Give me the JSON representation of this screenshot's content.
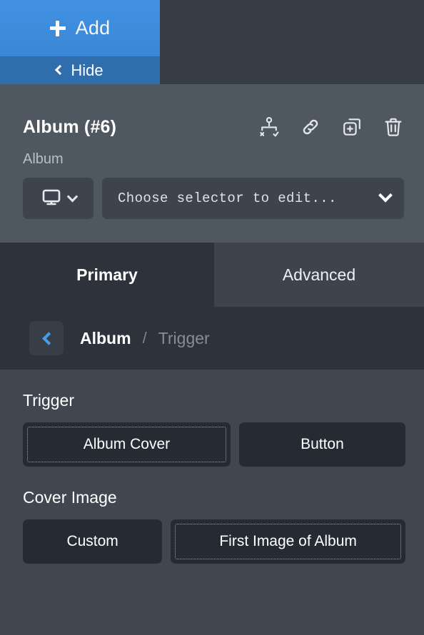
{
  "topbar": {
    "add_label": "Add",
    "add_icon": "plus-icon",
    "hide_label": "Hide",
    "hide_icon": "chevron-left-icon",
    "add_bg": "#3f8ddd",
    "hide_bg": "#2f6dad",
    "background": "#353c45"
  },
  "header": {
    "title": "Album (#6)",
    "subtitle": "Album",
    "background": "#4f5760",
    "icons": [
      {
        "name": "conditions-icon",
        "title": "Conditions"
      },
      {
        "name": "link-icon",
        "title": "Link"
      },
      {
        "name": "duplicate-icon",
        "title": "Duplicate"
      },
      {
        "name": "trash-icon",
        "title": "Delete"
      }
    ],
    "device": {
      "icon": "desktop-monitor-icon",
      "chevron": "chevron-down-icon"
    },
    "selector": {
      "value": "Choose selector to edit...",
      "chevron": "chevron-down-icon"
    }
  },
  "tabs": [
    {
      "label": "Primary",
      "active": true
    },
    {
      "label": "Advanced",
      "active": false
    }
  ],
  "breadcrumb": {
    "back_icon": "chevron-left-icon",
    "current": "Album",
    "separator": "/",
    "next": "Trigger"
  },
  "content": {
    "groups": [
      {
        "label": "Trigger",
        "options": [
          {
            "label": "Album Cover",
            "selected": true
          },
          {
            "label": "Button",
            "selected": false
          }
        ]
      },
      {
        "label": "Cover Image",
        "options": [
          {
            "label": "Custom",
            "selected": false
          },
          {
            "label": "First Image of Album",
            "selected": true
          }
        ]
      }
    ],
    "background": "#414751"
  },
  "colors": {
    "accent_blue": "#4a9be8",
    "button_fill": "#252b33",
    "panel_dark": "#2e333b"
  }
}
